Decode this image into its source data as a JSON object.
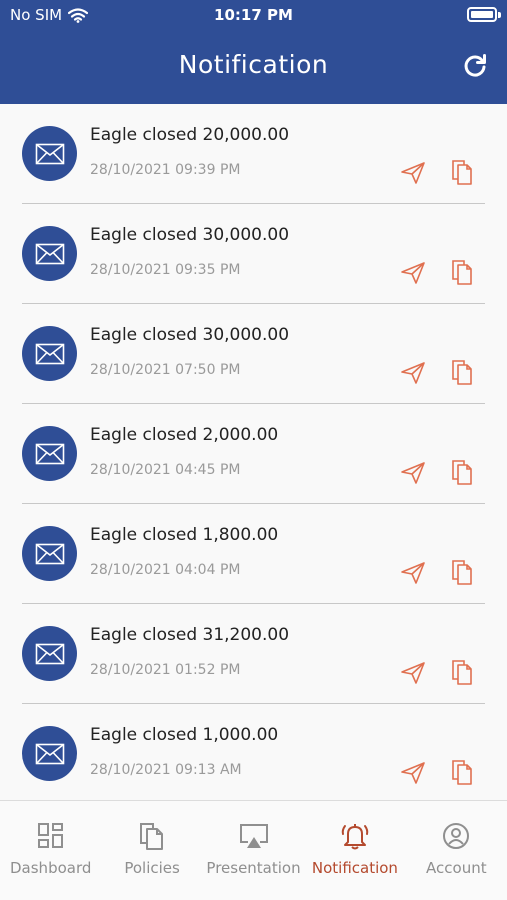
{
  "status_bar": {
    "carrier": "No SIM",
    "time": "10:17 PM"
  },
  "header": {
    "title": "Notification"
  },
  "colors": {
    "primary": "#2f4e96",
    "accent": "#e07050",
    "active_tab": "#b44a2e",
    "muted": "#8f8f8f"
  },
  "notifications": [
    {
      "title": "Eagle closed 20,000.00",
      "date": "28/10/2021 09:39 PM"
    },
    {
      "title": "Eagle closed 30,000.00",
      "date": "28/10/2021 09:35 PM"
    },
    {
      "title": "Eagle closed 30,000.00",
      "date": "28/10/2021 07:50 PM"
    },
    {
      "title": "Eagle closed 2,000.00",
      "date": "28/10/2021 04:45 PM"
    },
    {
      "title": "Eagle closed 1,800.00",
      "date": "28/10/2021 04:04 PM"
    },
    {
      "title": "Eagle closed 31,200.00",
      "date": "28/10/2021 01:52 PM"
    },
    {
      "title": "Eagle closed 1,000.00",
      "date": "28/10/2021 09:13 AM"
    }
  ],
  "tabs": [
    {
      "label": "Dashboard",
      "icon": "dashboard-icon",
      "active": false
    },
    {
      "label": "Policies",
      "icon": "policies-icon",
      "active": false
    },
    {
      "label": "Presentation",
      "icon": "presentation-icon",
      "active": false
    },
    {
      "label": "Notification",
      "icon": "bell-icon",
      "active": true
    },
    {
      "label": "Account",
      "icon": "account-icon",
      "active": false
    }
  ]
}
